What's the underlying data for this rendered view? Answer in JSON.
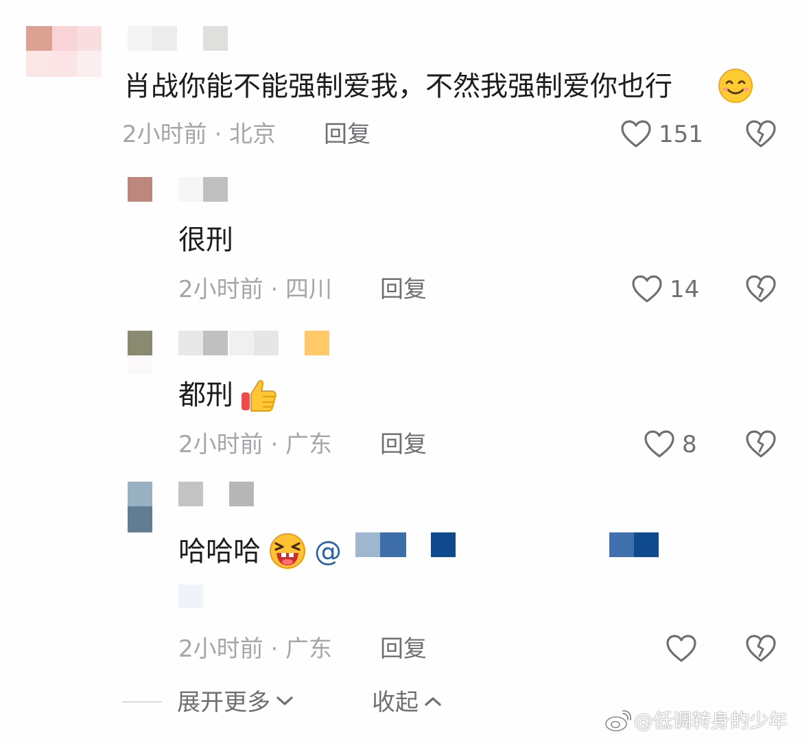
{
  "comments": [
    {
      "text": "肖战你能不能强制爱我，不然我强制爱你也行",
      "meta": "2小时前 · 北京",
      "reply": "回复",
      "likes": "151"
    },
    {
      "text": "很刑",
      "meta": "2小时前 · 四川",
      "reply": "回复",
      "likes": "14"
    },
    {
      "text": "都刑",
      "meta": "2小时前 · 广东",
      "reply": "回复",
      "likes": "8"
    },
    {
      "text": "哈哈哈",
      "mention": "@",
      "meta": "2小时前 · 广东",
      "reply": "回复",
      "likes": ""
    }
  ],
  "footer": {
    "expand_more": "展开更多",
    "collapse": "收起"
  },
  "watermark": "@低调转身的少年",
  "icons": {
    "like": "heart-outline-icon",
    "dislike": "broken-heart-icon",
    "expand": "chevron-down-icon",
    "collapse": "chevron-up-icon",
    "weibo": "weibo-logo-icon"
  },
  "colors": {
    "text": "#1c1c1e",
    "meta": "#a5a5aa",
    "action": "#6e6e73",
    "mention": "#2d63a6"
  }
}
